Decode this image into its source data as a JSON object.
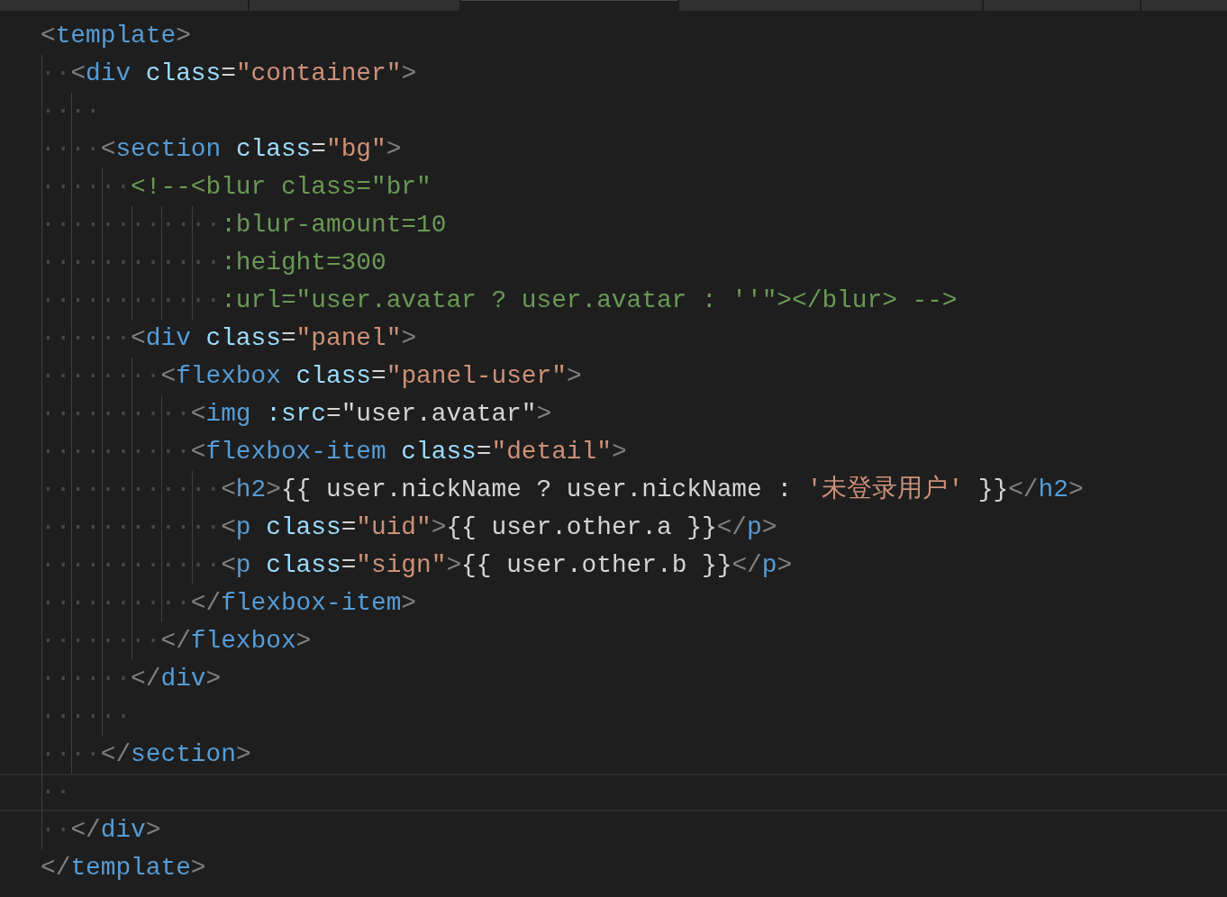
{
  "tabs": [
    {
      "selected": false
    },
    {
      "selected": false
    },
    {
      "selected": true
    },
    {
      "selected": false
    },
    {
      "selected": false
    },
    {
      "selected": false
    }
  ],
  "lines": [
    {
      "current": false,
      "tokens": [
        {
          "kind": "p",
          "t": "<"
        },
        {
          "kind": "tag",
          "t": "template"
        },
        {
          "kind": "p",
          "t": ">"
        }
      ]
    },
    {
      "current": false,
      "whitespace": "··",
      "tokens": [
        {
          "kind": "p",
          "t": "<"
        },
        {
          "kind": "tag",
          "t": "div"
        },
        {
          "kind": "attr",
          "t": " class"
        },
        {
          "kind": "x",
          "t": "="
        },
        {
          "kind": "str",
          "t": "\"container\""
        },
        {
          "kind": "p",
          "t": ">"
        }
      ]
    },
    {
      "current": false,
      "whitespace": "····"
    },
    {
      "current": false,
      "whitespace": "····",
      "tokens": [
        {
          "kind": "p",
          "t": "<"
        },
        {
          "kind": "tag",
          "t": "section"
        },
        {
          "kind": "attr",
          "t": " class"
        },
        {
          "kind": "x",
          "t": "="
        },
        {
          "kind": "str",
          "t": "\"bg\""
        },
        {
          "kind": "p",
          "t": ">"
        }
      ]
    },
    {
      "current": false,
      "whitespace": "······",
      "tokens": [
        {
          "kind": "com",
          "t": "<!--<blur class=\"br\""
        }
      ]
    },
    {
      "current": false,
      "whitespace": "············",
      "tokens": [
        {
          "kind": "com",
          "t": ":blur-amount=10"
        }
      ]
    },
    {
      "current": false,
      "whitespace": "············",
      "tokens": [
        {
          "kind": "com",
          "t": ":height=300"
        }
      ]
    },
    {
      "current": false,
      "whitespace": "············",
      "tokens": [
        {
          "kind": "com",
          "t": ":url=\"user.avatar ? user.avatar : ''\"></blur> -->"
        }
      ]
    },
    {
      "current": false,
      "whitespace": "······",
      "tokens": [
        {
          "kind": "p",
          "t": "<"
        },
        {
          "kind": "tag",
          "t": "div"
        },
        {
          "kind": "attr",
          "t": " class"
        },
        {
          "kind": "x",
          "t": "="
        },
        {
          "kind": "str",
          "t": "\"panel\""
        },
        {
          "kind": "p",
          "t": ">"
        }
      ]
    },
    {
      "current": false,
      "whitespace": "········",
      "tokens": [
        {
          "kind": "p",
          "t": "<"
        },
        {
          "kind": "tag",
          "t": "flexbox"
        },
        {
          "kind": "attr",
          "t": " class"
        },
        {
          "kind": "x",
          "t": "="
        },
        {
          "kind": "str",
          "t": "\"panel-user\""
        },
        {
          "kind": "p",
          "t": ">"
        }
      ]
    },
    {
      "current": false,
      "whitespace": "··········",
      "tokens": [
        {
          "kind": "p",
          "t": "<"
        },
        {
          "kind": "tag",
          "t": "img"
        },
        {
          "kind": "attr",
          "t": " :src"
        },
        {
          "kind": "x",
          "t": "=\"user.avatar\""
        },
        {
          "kind": "p",
          "t": ">"
        }
      ]
    },
    {
      "current": false,
      "whitespace": "··········",
      "tokens": [
        {
          "kind": "p",
          "t": "<"
        },
        {
          "kind": "tag",
          "t": "flexbox-item"
        },
        {
          "kind": "attr",
          "t": " class"
        },
        {
          "kind": "x",
          "t": "="
        },
        {
          "kind": "str",
          "t": "\"detail\""
        },
        {
          "kind": "p",
          "t": ">"
        }
      ]
    },
    {
      "current": false,
      "whitespace": "············",
      "tokens": [
        {
          "kind": "p",
          "t": "<"
        },
        {
          "kind": "tag",
          "t": "h2"
        },
        {
          "kind": "p",
          "t": ">"
        },
        {
          "kind": "x",
          "t": "{{ user.nickName ? user.nickName : "
        },
        {
          "kind": "str",
          "t": "'未登录用户'"
        },
        {
          "kind": "x",
          "t": " }}"
        },
        {
          "kind": "p",
          "t": "</"
        },
        {
          "kind": "tag",
          "t": "h2"
        },
        {
          "kind": "p",
          "t": ">"
        }
      ]
    },
    {
      "current": false,
      "whitespace": "············",
      "tokens": [
        {
          "kind": "p",
          "t": "<"
        },
        {
          "kind": "tag",
          "t": "p"
        },
        {
          "kind": "attr",
          "t": " class"
        },
        {
          "kind": "x",
          "t": "="
        },
        {
          "kind": "str",
          "t": "\"uid\""
        },
        {
          "kind": "p",
          "t": ">"
        },
        {
          "kind": "x",
          "t": "{{ user.other.a }}"
        },
        {
          "kind": "p",
          "t": "</"
        },
        {
          "kind": "tag",
          "t": "p"
        },
        {
          "kind": "p",
          "t": ">"
        }
      ]
    },
    {
      "current": false,
      "whitespace": "············",
      "tokens": [
        {
          "kind": "p",
          "t": "<"
        },
        {
          "kind": "tag",
          "t": "p"
        },
        {
          "kind": "attr",
          "t": " class"
        },
        {
          "kind": "x",
          "t": "="
        },
        {
          "kind": "str",
          "t": "\"sign\""
        },
        {
          "kind": "p",
          "t": ">"
        },
        {
          "kind": "x",
          "t": "{{ user.other.b }}"
        },
        {
          "kind": "p",
          "t": "</"
        },
        {
          "kind": "tag",
          "t": "p"
        },
        {
          "kind": "p",
          "t": ">"
        }
      ]
    },
    {
      "current": false,
      "whitespace": "··········",
      "tokens": [
        {
          "kind": "p",
          "t": "</"
        },
        {
          "kind": "tag",
          "t": "flexbox-item"
        },
        {
          "kind": "p",
          "t": ">"
        }
      ]
    },
    {
      "current": false,
      "whitespace": "········",
      "tokens": [
        {
          "kind": "p",
          "t": "</"
        },
        {
          "kind": "tag",
          "t": "flexbox"
        },
        {
          "kind": "p",
          "t": ">"
        }
      ]
    },
    {
      "current": false,
      "whitespace": "······",
      "tokens": [
        {
          "kind": "p",
          "t": "</"
        },
        {
          "kind": "tag",
          "t": "div"
        },
        {
          "kind": "p",
          "t": ">"
        }
      ]
    },
    {
      "current": false,
      "whitespace": "······"
    },
    {
      "current": false,
      "whitespace": "····",
      "tokens": [
        {
          "kind": "p",
          "t": "</"
        },
        {
          "kind": "tag",
          "t": "section"
        },
        {
          "kind": "p",
          "t": ">"
        }
      ]
    },
    {
      "current": true,
      "whitespace": "··"
    },
    {
      "current": false,
      "whitespace": "··",
      "tokens": [
        {
          "kind": "p",
          "t": "</"
        },
        {
          "kind": "tag",
          "t": "div"
        },
        {
          "kind": "p",
          "t": ">"
        }
      ]
    },
    {
      "current": false,
      "tokens": [
        {
          "kind": "p",
          "t": "</"
        },
        {
          "kind": "tag",
          "t": "template"
        },
        {
          "kind": "p",
          "t": ">"
        }
      ]
    }
  ]
}
